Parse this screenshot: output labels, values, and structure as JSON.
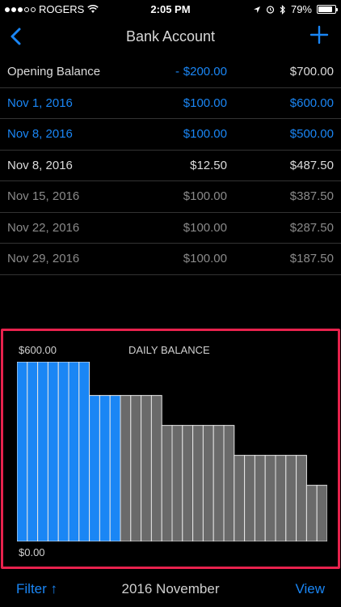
{
  "status_bar": {
    "carrier": "ROGERS",
    "time": "2:05 PM",
    "battery": "79%",
    "signal_bars_filled": 3
  },
  "nav": {
    "title": "Bank Account",
    "back_icon": "chevron-left-icon",
    "add_icon": "plus-icon"
  },
  "rows": [
    {
      "label": "Opening Balance",
      "dash": "-",
      "amount": "$200.00",
      "balance": "$700.00",
      "label_color": "#dcdcdc",
      "amount_color": "#1a86f5",
      "balance_color": "#dcdcdc"
    },
    {
      "label": "Nov 1, 2016",
      "dash": "",
      "amount": "$100.00",
      "balance": "$600.00",
      "label_color": "#1a86f5",
      "amount_color": "#1a86f5",
      "balance_color": "#1a86f5"
    },
    {
      "label": "Nov 8, 2016",
      "dash": "",
      "amount": "$100.00",
      "balance": "$500.00",
      "label_color": "#1a86f5",
      "amount_color": "#1a86f5",
      "balance_color": "#1a86f5"
    },
    {
      "label": "Nov 8, 2016",
      "dash": "",
      "amount": "$12.50",
      "balance": "$487.50",
      "label_color": "#dcdcdc",
      "amount_color": "#dcdcdc",
      "balance_color": "#dcdcdc"
    },
    {
      "label": "Nov 15, 2016",
      "dash": "",
      "amount": "$100.00",
      "balance": "$387.50",
      "label_color": "#8a8a8a",
      "amount_color": "#8a8a8a",
      "balance_color": "#8a8a8a"
    },
    {
      "label": "Nov 22, 2016",
      "dash": "",
      "amount": "$100.00",
      "balance": "$287.50",
      "label_color": "#8a8a8a",
      "amount_color": "#8a8a8a",
      "balance_color": "#8a8a8a"
    },
    {
      "label": "Nov 29, 2016",
      "dash": "",
      "amount": "$100.00",
      "balance": "$187.50",
      "label_color": "#8a8a8a",
      "amount_color": "#8a8a8a",
      "balance_color": "#8a8a8a"
    }
  ],
  "chart": {
    "title": "DAILY BALANCE",
    "max_label": "$600.00",
    "min_label": "$0.00"
  },
  "chart_data": {
    "type": "bar",
    "title": "DAILY BALANCE",
    "ylim": [
      0,
      600
    ],
    "days": [
      1,
      2,
      3,
      4,
      5,
      6,
      7,
      8,
      9,
      10,
      11,
      12,
      13,
      14,
      15,
      16,
      17,
      18,
      19,
      20,
      21,
      22,
      23,
      24,
      25,
      26,
      27,
      28,
      29,
      30
    ],
    "values": [
      600,
      600,
      600,
      600,
      600,
      600,
      600,
      487.5,
      487.5,
      487.5,
      487.5,
      487.5,
      487.5,
      487.5,
      387.5,
      387.5,
      387.5,
      387.5,
      387.5,
      387.5,
      387.5,
      287.5,
      287.5,
      287.5,
      287.5,
      287.5,
      287.5,
      287.5,
      187.5,
      187.5
    ],
    "colors": [
      "#1a86f5",
      "#1a86f5",
      "#1a86f5",
      "#1a86f5",
      "#1a86f5",
      "#1a86f5",
      "#1a86f5",
      "#1a86f5",
      "#1a86f5",
      "#1a86f5",
      "#6a6a6a",
      "#6a6a6a",
      "#6a6a6a",
      "#6a6a6a",
      "#6a6a6a",
      "#6a6a6a",
      "#6a6a6a",
      "#6a6a6a",
      "#6a6a6a",
      "#6a6a6a",
      "#6a6a6a",
      "#6a6a6a",
      "#6a6a6a",
      "#6a6a6a",
      "#6a6a6a",
      "#6a6a6a",
      "#6a6a6a",
      "#6a6a6a",
      "#6a6a6a",
      "#6a6a6a"
    ]
  },
  "toolbar": {
    "filter_label": "Filter ↑",
    "month_label": "2016 November",
    "view_label": "View"
  }
}
